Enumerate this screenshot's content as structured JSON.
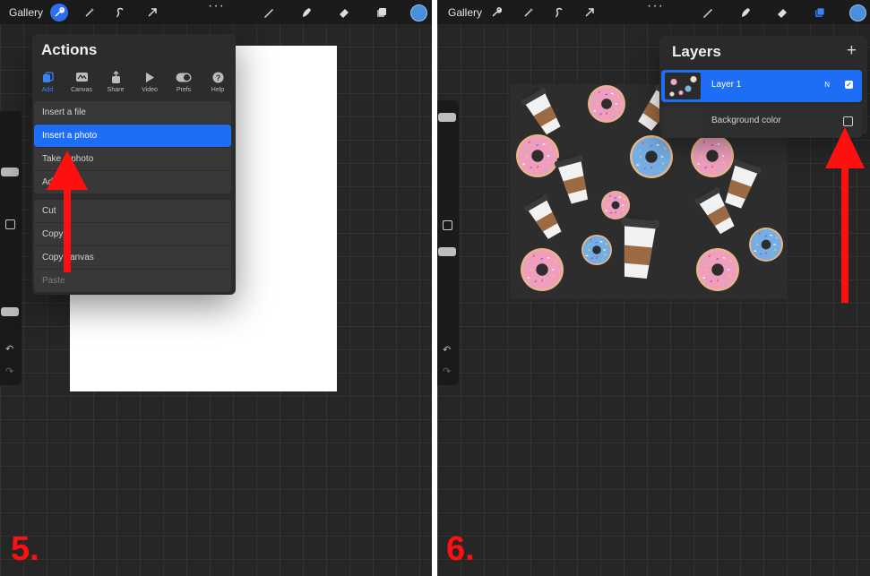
{
  "left": {
    "topbar": {
      "gallery_label": "Gallery",
      "icons": [
        "wrench-icon",
        "magic-wand-icon",
        "selection-icon",
        "transform-arrow-icon",
        "more-dots-icon",
        "brush-icon",
        "smudge-icon",
        "eraser-icon",
        "layers-icon",
        "color-swatch"
      ]
    },
    "actions_menu": {
      "title": "Actions",
      "tabs": [
        {
          "label": "Add",
          "icon": "add-icon",
          "selected": true
        },
        {
          "label": "Canvas",
          "icon": "canvas-icon"
        },
        {
          "label": "Share",
          "icon": "share-icon"
        },
        {
          "label": "Video",
          "icon": "video-icon"
        },
        {
          "label": "Prefs",
          "icon": "prefs-toggle-icon"
        },
        {
          "label": "Help",
          "icon": "help-icon"
        }
      ],
      "group1": [
        "Insert a file",
        "Insert a photo",
        "Take a photo",
        "Add"
      ],
      "group2": [
        "Cut",
        "Copy",
        "Copy canvas",
        "Paste"
      ]
    },
    "step_label": "5."
  },
  "right": {
    "topbar": {
      "gallery_label": "Gallery"
    },
    "layers_panel": {
      "title": "Layers",
      "layers": [
        {
          "name": "Layer 1",
          "blend_mode": "N",
          "visible": true,
          "selected": true
        },
        {
          "name": "Background color",
          "visible": false
        }
      ]
    },
    "step_label": "6."
  },
  "colors": {
    "accent_blue": "#1e6ef5",
    "arrow_red": "#ff1010",
    "canvas_bg": "#262626",
    "donut_pink": "#ef9fbd",
    "donut_blue": "#74aee4"
  }
}
